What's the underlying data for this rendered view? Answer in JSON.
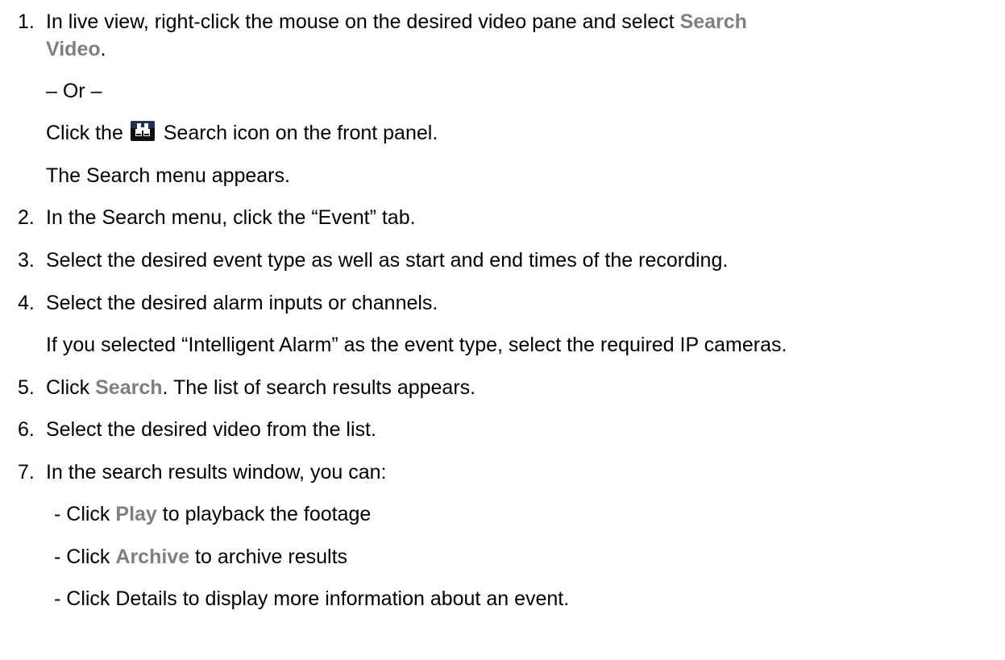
{
  "colors": {
    "text": "#000000",
    "highlight": "#7f7f7f",
    "icon_dark": "#101010",
    "icon_accent": "#2a4f8a"
  },
  "steps": [
    {
      "num": "1.",
      "line1_pre": "In live view, right-click the mouse on the desired video pane and select ",
      "line1_hl": "Search",
      "line2_hl": "Video",
      "line2_post": ".",
      "or_text": "– Or –",
      "click_pre": "Click the ",
      "icon": "binoculars-icon",
      "click_post": " Search icon on the front panel.",
      "result": "The Search menu appears."
    },
    {
      "num": "2.",
      "text": "In the Search menu, click the “Event” tab."
    },
    {
      "num": "3.",
      "text": "Select the desired event type as well as start and end times of the recording."
    },
    {
      "num": "4.",
      "text": "Select the desired alarm inputs or channels.",
      "note": "If you selected “Intelligent Alarm” as the event type, select the required IP cameras."
    },
    {
      "num": "5.",
      "pre": "Click ",
      "hl": "Search",
      "post": ". The list of search results appears."
    },
    {
      "num": "6.",
      "text": "Select the desired video from the list."
    },
    {
      "num": "7.",
      "text": "In the search results window, you can:",
      "options": [
        {
          "pre": "- Click ",
          "hl": "Play",
          "post": " to playback the footage"
        },
        {
          "pre": "- Click ",
          "hl": "Archive",
          "post": " to archive results"
        },
        {
          "pre": "- Click Details to display more information about an event.",
          "hl": "",
          "post": ""
        }
      ]
    }
  ]
}
